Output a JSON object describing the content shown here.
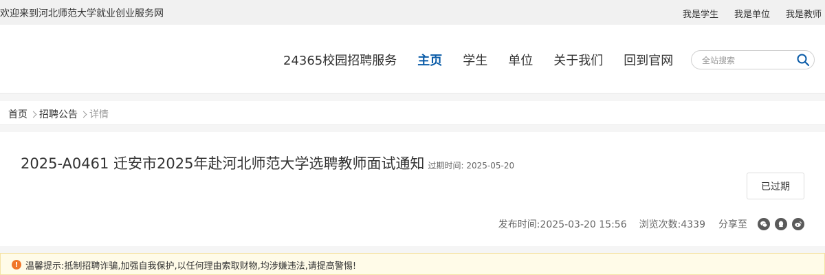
{
  "topbar": {
    "welcome": "欢迎来到河北师范大学就业创业服务网",
    "links": [
      "我是学生",
      "我是单位",
      "我是教师"
    ]
  },
  "nav": {
    "items": [
      "24365校园招聘服务",
      "主页",
      "学生",
      "单位",
      "关于我们",
      "回到官网"
    ],
    "active": "主页"
  },
  "search": {
    "placeholder": "全站搜索",
    "value": "",
    "icon": "search-icon"
  },
  "breadcrumb": {
    "home": "首页",
    "section": "招聘公告",
    "current": "详情"
  },
  "article": {
    "title": "2025-A0461 迁安市2025年赴河北师范大学选聘教师面试通知",
    "expire_label": "过期时间:",
    "expire_date": "2025-05-20",
    "status": "已过期",
    "publish_label": "发布时间:",
    "publish_time": "2025-03-20 15:56",
    "views_label": "浏览次数:",
    "views": "4339",
    "share_label": "分享至",
    "share_icons": [
      "wechat-icon",
      "qq-icon",
      "weibo-icon"
    ]
  },
  "notice": {
    "icon": "warning-icon",
    "text": "温馨提示:抵制招聘诈骗,加强自我保护,以任何理由索取财物,均涉嫌违法,请提高警惕!"
  },
  "colors": {
    "accent": "#0b5ca8",
    "notice_bg": "#fffbe8",
    "warning": "#f0762a"
  }
}
